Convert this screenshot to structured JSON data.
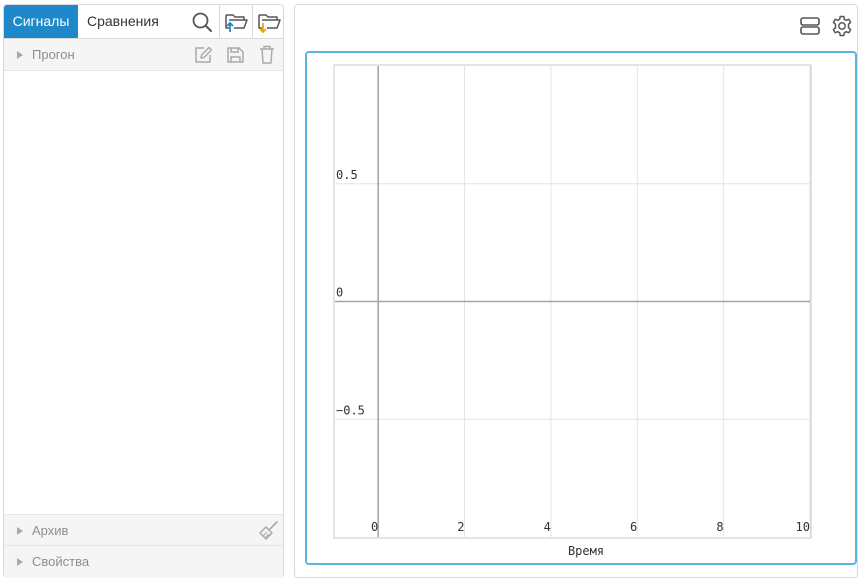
{
  "tabs": {
    "signals": "Сигналы",
    "comparisons": "Сравнения"
  },
  "toolbar_icons": [
    "search-icon",
    "folder-upload-icon",
    "folder-download-icon"
  ],
  "sections": {
    "run": {
      "label": "Прогон",
      "icons": [
        "edit-icon",
        "save-icon",
        "trash-icon"
      ]
    },
    "archive": {
      "label": "Архив",
      "icons": [
        "broom-icon"
      ]
    },
    "properties": {
      "label": "Свойства"
    }
  },
  "chart_toolbar_icons": [
    "layout-rows-icon",
    "gear-icon"
  ],
  "colors": {
    "accent": "#1e88c8",
    "chart_border": "#5ab4de"
  },
  "chart_data": {
    "type": "line",
    "series": [],
    "title": "",
    "xlabel": "Время",
    "ylabel": "",
    "xlim": [
      -1,
      10
    ],
    "ylim": [
      -1,
      1
    ],
    "xticks": [
      0,
      2,
      4,
      6,
      8,
      10
    ],
    "yticks": [
      0.5,
      0,
      -0.5
    ],
    "xtick_labels": [
      "0",
      "2",
      "4",
      "6",
      "8",
      "10"
    ],
    "ytick_labels": [
      "0.5",
      "0",
      "−0.5"
    ],
    "grid": true
  }
}
